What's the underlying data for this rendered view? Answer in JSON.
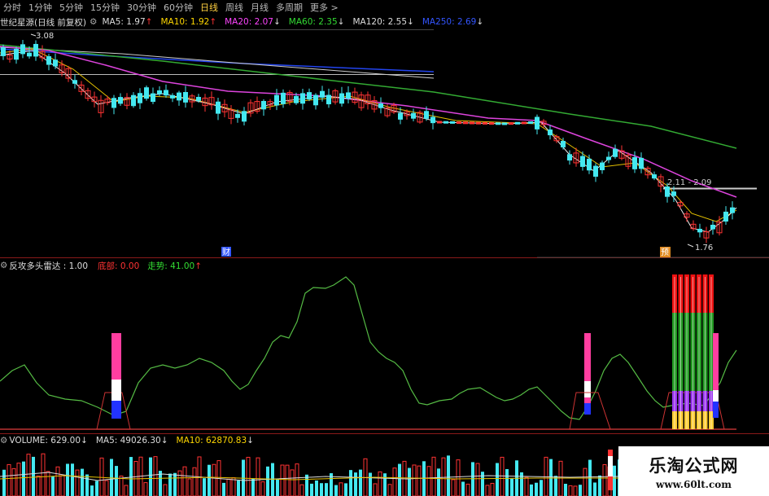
{
  "toolbar": {
    "tabs": [
      "分时",
      "1分钟",
      "5分钟",
      "15分钟",
      "30分钟",
      "60分钟",
      "日线",
      "周线",
      "月线",
      "多周期",
      "更多 >"
    ],
    "active": "日线"
  },
  "price_panel": {
    "title": "世纪星源(日线 前复权)",
    "ma": [
      {
        "label": "MA5: 1.97",
        "arrow": "↑",
        "color": "#dddddd"
      },
      {
        "label": "MA10: 1.92",
        "arrow": "↑",
        "color": "#ffd700"
      },
      {
        "label": "MA20: 2.07",
        "arrow": "↓",
        "color": "#ff44ff"
      },
      {
        "label": "MA60: 2.35",
        "arrow": "↓",
        "color": "#33dd33"
      },
      {
        "label": "MA120: 2.55",
        "arrow": "↓",
        "color": "#dddddd"
      },
      {
        "label": "MA250: 2.69",
        "arrow": "↓",
        "color": "#3355ff"
      }
    ],
    "high_label": "3.08",
    "low_label": "1.76",
    "range_label": "2.11 - 2.09",
    "marker_cai": "财",
    "marker_yu": "预"
  },
  "indicator_panel": {
    "title": "反攻多头雷达 : 1.00",
    "items": [
      {
        "label": "底部: 0.00",
        "arrow": "",
        "color": "#ff3333"
      },
      {
        "label": "走势: 41.00",
        "arrow": "↑",
        "color": "#33dd33"
      }
    ]
  },
  "volume_panel": {
    "items": [
      {
        "label": "VOLUME: 629.00",
        "arrow": "↓",
        "color": "#dddddd"
      },
      {
        "label": "MA5: 49026.30",
        "arrow": "↓",
        "color": "#dddddd"
      },
      {
        "label": "MA10: 62870.83",
        "arrow": "↓",
        "color": "#ffd700"
      }
    ]
  },
  "watermark": {
    "title": "乐淘公式网",
    "url": "www.60lt.com"
  },
  "colors": {
    "up": "#ff3333",
    "down": "#44e8f0",
    "trend": "#55bb44",
    "pink": "#ff3ea0",
    "red_bar": "#ee1111",
    "green_bar": "#229922",
    "purple_bar": "#9933ee",
    "yellow_bar": "#ffcc33"
  }
}
